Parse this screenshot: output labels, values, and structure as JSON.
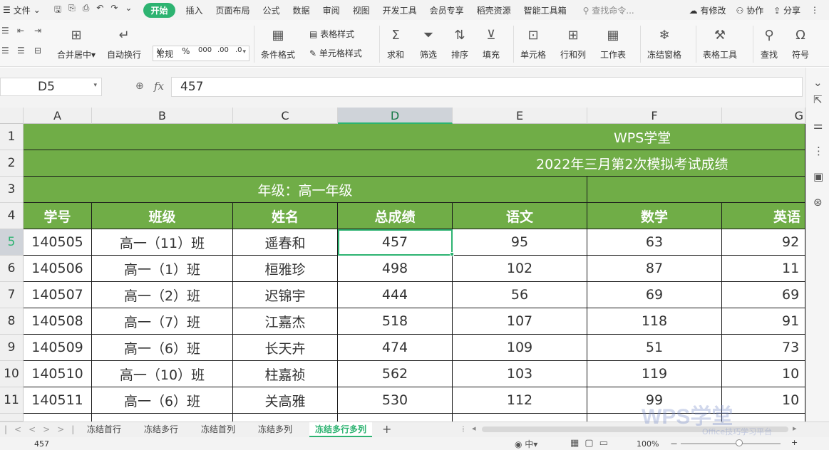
{
  "menubar": {
    "file": "文件",
    "tabs": [
      "开始",
      "插入",
      "页面布局",
      "公式",
      "数据",
      "审阅",
      "视图",
      "开发工具",
      "会员专享",
      "稻壳资源",
      "智能工具箱"
    ],
    "search": "查找命令...",
    "right": [
      "有修改",
      "协作",
      "分享"
    ]
  },
  "ribbon": {
    "merge": "合并居中",
    "merge_arrow": "▾",
    "wrap": "自动换行",
    "number_format": "常规",
    "currency": "¥",
    "percent": "%",
    "thousands": "000",
    "inc_decimal": ".00",
    "dec_decimal": ".0",
    "table_style": "表格样式",
    "cell_style": "单元格样式",
    "cond_format": "条件格式",
    "sum": "求和",
    "filter": "筛选",
    "sort": "排序",
    "fill": "填充",
    "cell": "单元格",
    "rowcol": "行和列",
    "worksheet": "工作表",
    "freeze": "冻结窗格",
    "table_tools": "表格工具",
    "find": "查找",
    "symbol": "符号"
  },
  "formula_bar": {
    "name_box": "D5",
    "fx": "fx",
    "content": "457"
  },
  "columns": [
    "A",
    "B",
    "C",
    "D",
    "E",
    "F",
    "G"
  ],
  "rows": [
    "1",
    "2",
    "3",
    "4",
    "5",
    "6",
    "7",
    "8",
    "9",
    "10",
    "11"
  ],
  "sheet": {
    "title": "WPS学堂",
    "subtitle": "2022年三月第2次模拟考试成绩",
    "grade": "年级：高一年级",
    "headers": [
      "学号",
      "班级",
      "姓名",
      "总成绩",
      "语文",
      "数学",
      "英语"
    ],
    "data": [
      [
        "140505",
        "高一（11）班",
        "遥春和",
        "457",
        "95",
        "63",
        "92"
      ],
      [
        "140506",
        "高一（1）班",
        "桓雅珍",
        "498",
        "102",
        "87",
        "11"
      ],
      [
        "140507",
        "高一（2）班",
        "迟锦宇",
        "444",
        "56",
        "69",
        "69"
      ],
      [
        "140508",
        "高一（7）班",
        "江嘉杰",
        "518",
        "107",
        "118",
        "91"
      ],
      [
        "140509",
        "高一（6）班",
        "长天卉",
        "474",
        "109",
        "51",
        "73"
      ],
      [
        "140510",
        "高一（10）班",
        "柱嘉祯",
        "562",
        "103",
        "119",
        "10"
      ],
      [
        "140511",
        "高一（6）班",
        "关高雅",
        "530",
        "112",
        "99",
        "10"
      ]
    ]
  },
  "tabs": {
    "sheets": [
      "冻结首行",
      "冻结多行",
      "冻结首列",
      "冻结多列",
      "冻结多行多列"
    ],
    "active": "冻结多行多列",
    "add": "+"
  },
  "status": {
    "value": "457",
    "zoom": "100%",
    "zoom_minus": "－",
    "zoom_plus": "+"
  },
  "watermark": {
    "main": "WPS学堂",
    "sub": "Office技巧学习平台"
  }
}
